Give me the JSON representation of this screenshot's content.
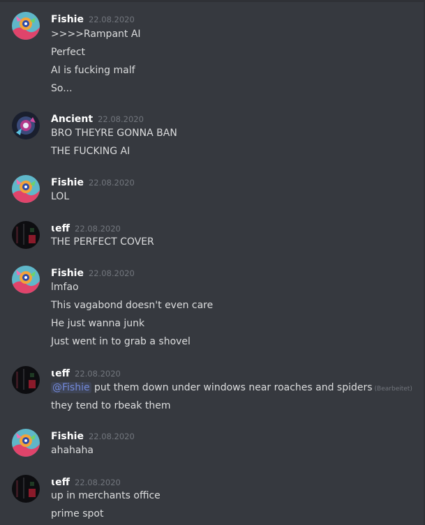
{
  "theme": {
    "background": "#36393f",
    "username_color": "#ffffff",
    "text_color": "#dcddde",
    "timestamp_color": "#72767d",
    "mention_color": "#7289da"
  },
  "messages": [
    {
      "author": "Fishie",
      "avatar": "fishie-avatar",
      "timestamp": "22.08.2020",
      "lines": [
        ">>>>Rampant AI",
        "Perfect",
        "AI is fucking malf",
        "So..."
      ]
    },
    {
      "author": "Ancient",
      "avatar": "ancient-avatar",
      "timestamp": "22.08.2020",
      "lines": [
        "BRO THEYRE GONNA BAN",
        "THE FUCKING AI"
      ]
    },
    {
      "author": "Fishie",
      "avatar": "fishie-avatar",
      "timestamp": "22.08.2020",
      "lines": [
        "LOL"
      ]
    },
    {
      "author": "ɩeff",
      "avatar": "jeff-avatar",
      "timestamp": "22.08.2020",
      "lines": [
        "THE PERFECT COVER"
      ]
    },
    {
      "author": "Fishie",
      "avatar": "fishie-avatar",
      "timestamp": "22.08.2020",
      "lines": [
        "lmfao",
        "This vagabond doesn't even care",
        "He just wanna junk",
        "Just went in to grab a shovel"
      ]
    },
    {
      "author": "ɩeff",
      "avatar": "jeff-avatar",
      "timestamp": "22.08.2020",
      "mention": "@Fishie",
      "mention_text": " put them down under windows near roaches and spiders",
      "edited": "(Bearbeitet)",
      "lines": [
        "they tend to rbeak them"
      ]
    },
    {
      "author": "Fishie",
      "avatar": "fishie-avatar",
      "timestamp": "22.08.2020",
      "lines": [
        "ahahaha"
      ]
    },
    {
      "author": "ɩeff",
      "avatar": "jeff-avatar",
      "timestamp": "22.08.2020",
      "lines": [
        "up in merchants office",
        "prime spot"
      ]
    }
  ]
}
